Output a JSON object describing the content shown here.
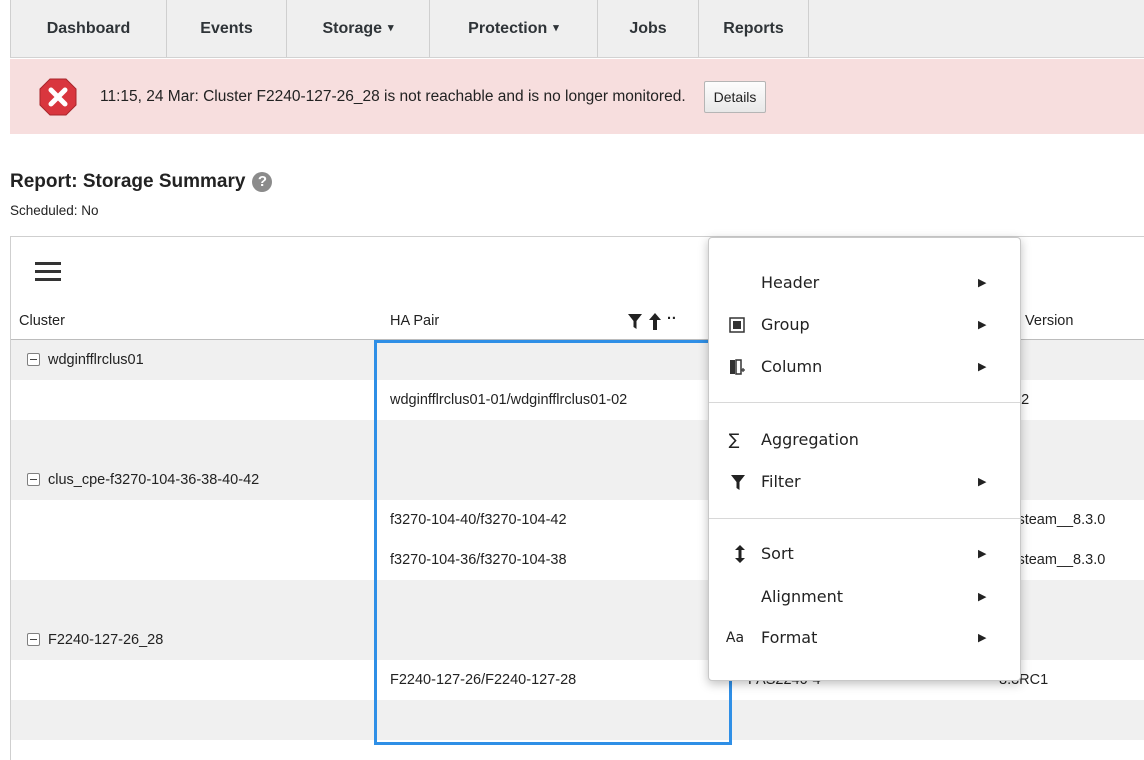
{
  "nav": {
    "dashboard": "Dashboard",
    "events": "Events",
    "storage": "Storage",
    "protection": "Protection",
    "jobs": "Jobs",
    "reports": "Reports"
  },
  "alert": {
    "message": "11:15, 24 Mar: Cluster F2240-127-26_28 is not reachable and is no longer monitored.",
    "details_label": "Details"
  },
  "report": {
    "title": "Report: Storage Summary",
    "scheduled": "Scheduled: No"
  },
  "table": {
    "headers": {
      "cluster": "Cluster",
      "ha_pair": "HA Pair",
      "version_partial": "; Version"
    },
    "groups": [
      {
        "cluster": "wdginfflrclus01",
        "rows": [
          {
            "ha_pair": "wdginfflrclus01-01/wdginfflrclus01-02",
            "model": "",
            "version": "2.2"
          }
        ]
      },
      {
        "cluster": "clus_cpe-f3270-104-36-38-40-42",
        "rows": [
          {
            "ha_pair": "f3270-104-40/f3270-104-42",
            "model": "",
            "version": "llsteam__8.3.0"
          },
          {
            "ha_pair": "f3270-104-36/f3270-104-38",
            "model": "",
            "version": "llsteam__8.3.0"
          }
        ]
      },
      {
        "cluster": "F2240-127-26_28",
        "rows": [
          {
            "ha_pair": "F2240-127-26/F2240-127-28",
            "model": "FAS2240-4",
            "version": "8.3RC1"
          }
        ]
      }
    ]
  },
  "menu": {
    "header": "Header",
    "group": "Group",
    "column": "Column",
    "aggregation": "Aggregation",
    "filter": "Filter",
    "sort": "Sort",
    "alignment": "Alignment",
    "format": "Format",
    "format_icon": "Aa",
    "aggregation_icon": "∑"
  },
  "colors": {
    "alert_bg": "#f7dede",
    "alert_icon": "#d9363e",
    "selection": "#2f8fe6"
  }
}
